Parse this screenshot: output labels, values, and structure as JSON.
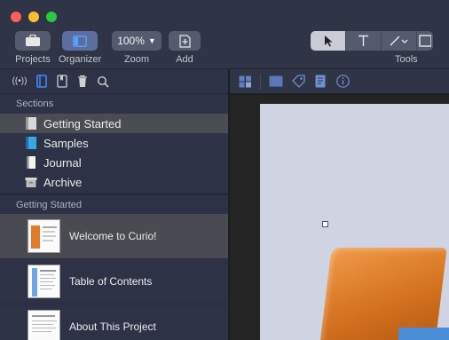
{
  "window": {
    "traffic_colors": {
      "close": "#fe5f57",
      "minimize": "#febc2e",
      "zoom": "#28c840"
    }
  },
  "toolbar": {
    "projects_label": "Projects",
    "organizer_label": "Organizer",
    "zoom_label": "Zoom",
    "zoom_value": "100%",
    "add_label": "Add",
    "tools_label": "Tools",
    "accent": "#2f6ee0"
  },
  "sidebar": {
    "sections_header": "Sections",
    "sections": [
      {
        "label": "Getting Started",
        "selected": true
      },
      {
        "label": "Samples",
        "selected": false
      },
      {
        "label": "Journal",
        "selected": false
      },
      {
        "label": "Archive",
        "selected": false
      }
    ],
    "pages_header": "Getting Started",
    "pages": [
      {
        "label": "Welcome to Curio!",
        "selected": true
      },
      {
        "label": "Table of Contents",
        "selected": false
      },
      {
        "label": "About This Project",
        "selected": false
      }
    ]
  }
}
